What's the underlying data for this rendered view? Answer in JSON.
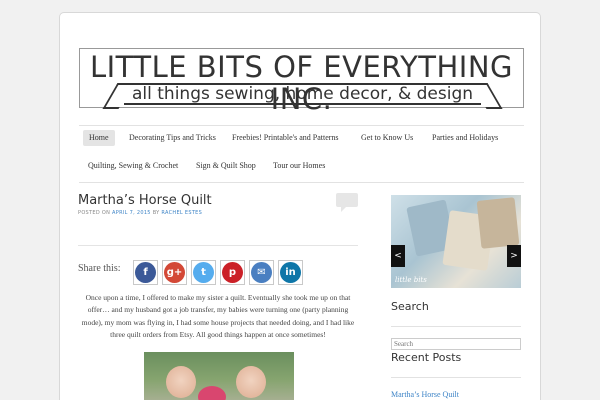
{
  "header": {
    "title": "LITTLE BITS OF EVERYTHING INC.",
    "tagline": "all things sewing, home decor, &  design"
  },
  "nav": {
    "items": [
      {
        "label": "Home",
        "active": true
      },
      {
        "label": "Decorating Tips and Tricks"
      },
      {
        "label": "Freebies! Printable's and Patterns"
      },
      {
        "label": "Get to Know Us"
      },
      {
        "label": "Parties and Holidays"
      },
      {
        "label": "Quilting, Sewing & Crochet"
      },
      {
        "label": "Sign & Quilt Shop"
      },
      {
        "label": "Tour our Homes"
      }
    ]
  },
  "post": {
    "title": "Martha’s Horse Quilt",
    "meta_prefix": "POSTED ON",
    "meta_date": "APRIL 7, 2015",
    "meta_by": "BY",
    "meta_author": "RACHEL ESTES",
    "share_label": "Share this:",
    "share_buttons": [
      {
        "name": "facebook",
        "glyph": "f",
        "color": "#3b5998"
      },
      {
        "name": "google-plus",
        "glyph": "g+",
        "color": "#d34836"
      },
      {
        "name": "twitter",
        "glyph": "t",
        "color": "#55acee"
      },
      {
        "name": "pinterest",
        "glyph": "p",
        "color": "#cb2027"
      },
      {
        "name": "email",
        "glyph": "✉",
        "color": "#4a7fc1"
      },
      {
        "name": "linkedin",
        "glyph": "in",
        "color": "#0e76a8"
      }
    ],
    "body": "Once upon a time, I offered to make my sister a quilt. Eventually she took me up on that offer… and my husband got a job transfer, my babies were turning one (party planning mode), my mom was flying in, I had some house projects that needed doing, and I had like three quilt orders from Etsy. All good things happen at once sometimes!"
  },
  "sidebar": {
    "slider_prev": "<",
    "slider_next": ">",
    "slider_caption": "little bits",
    "search_title": "Search",
    "search_placeholder": "Search",
    "recent_title": "Recent Posts",
    "recent_posts": [
      "Martha’s Horse Quilt"
    ]
  },
  "colors": {
    "link": "#3f85c7",
    "nav_active_bg": "#e4e4e4"
  }
}
